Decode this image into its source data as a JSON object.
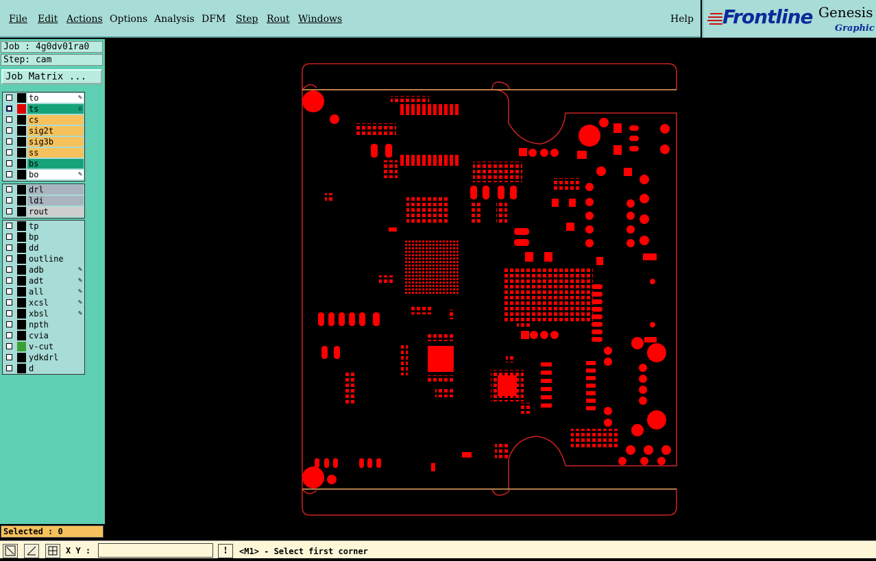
{
  "menu": {
    "file": "File",
    "edit": "Edit",
    "actions": "Actions",
    "options": "Options",
    "analysis": "Analysis",
    "dfm": "DFM",
    "step": "Step",
    "rout": "Rout",
    "windows": "Windows",
    "help": "Help"
  },
  "brand": {
    "logo": "Frontline",
    "product": "Genesis",
    "sub": "Graphic E"
  },
  "job": {
    "job_label": "Job : 4g0dv01ra0",
    "step_label": "Step: cam",
    "matrix_button": "Job Matrix ..."
  },
  "layers": {
    "board": [
      {
        "name": "to",
        "bg": "#ffffff",
        "mark": "✎"
      },
      {
        "name": "ts",
        "bg": "#16a37a",
        "mark": "▫",
        "checked": true,
        "swatch": "#e00000"
      },
      {
        "name": "cs",
        "bg": "#f5c15c"
      },
      {
        "name": "sig2t",
        "bg": "#f5c15c"
      },
      {
        "name": "sig3b",
        "bg": "#f5c15c"
      },
      {
        "name": "ss",
        "bg": "#f5c15c"
      },
      {
        "name": "bs",
        "bg": "#16a37a"
      },
      {
        "name": "bo",
        "bg": "#ffffff",
        "mark": "✎"
      }
    ],
    "drill": [
      {
        "name": "drl",
        "bg": "#a9b4bf"
      },
      {
        "name": "ldi",
        "bg": "#a9b4bf"
      },
      {
        "name": "rout",
        "bg": "#cfcfcf"
      }
    ],
    "misc": [
      {
        "name": "tp",
        "bg": "#a8dcd6"
      },
      {
        "name": "bp",
        "bg": "#a8dcd6"
      },
      {
        "name": "dd",
        "bg": "#a8dcd6"
      },
      {
        "name": "outline",
        "bg": "#a8dcd6"
      },
      {
        "name": "adb",
        "bg": "#a8dcd6",
        "mark": "✎"
      },
      {
        "name": "adt",
        "bg": "#a8dcd6",
        "mark": "✎"
      },
      {
        "name": "all",
        "bg": "#a8dcd6",
        "mark": "✎"
      },
      {
        "name": "xcsl",
        "bg": "#a8dcd6",
        "mark": "✎"
      },
      {
        "name": "xbsl",
        "bg": "#a8dcd6",
        "mark": "✎"
      },
      {
        "name": "npth",
        "bg": "#a8dcd6"
      },
      {
        "name": "cvia",
        "bg": "#a8dcd6"
      },
      {
        "name": "v-cut",
        "bg": "#a8dcd6",
        "swatch": "#3aa033"
      },
      {
        "name": "ydkdrl",
        "bg": "#a8dcd6"
      },
      {
        "name": "d",
        "bg": "#a8dcd6"
      }
    ]
  },
  "selected": "Selected : 0",
  "status": {
    "xy_label": "X Y :",
    "xy_value": "",
    "excl": "!",
    "prompt": "<M1> - Select first corner"
  },
  "colors": {
    "accent_red": "#ff0000",
    "outline": "#cc2222",
    "vcut": "#c8a060"
  }
}
